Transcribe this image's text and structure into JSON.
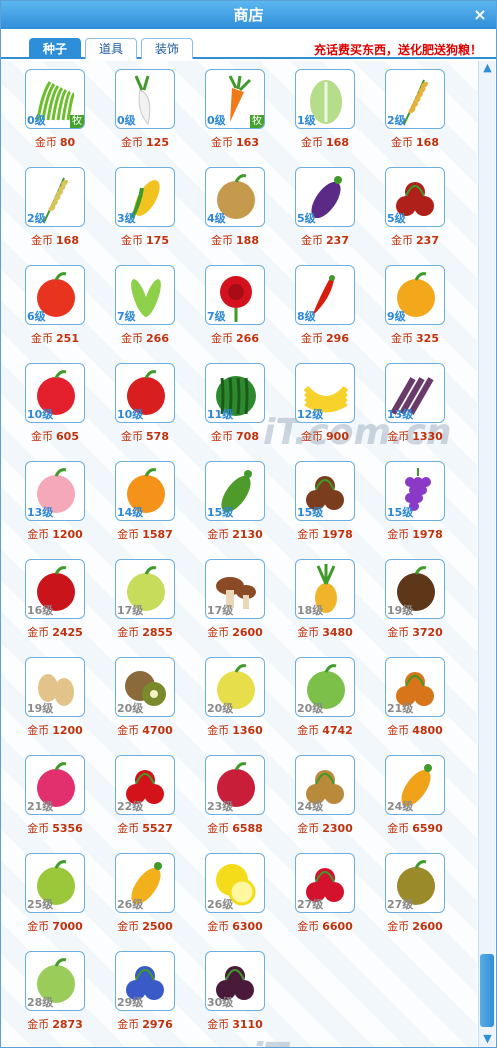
{
  "window": {
    "title": "商店",
    "close_label": "×"
  },
  "tabs": [
    {
      "label": "种子",
      "active": true
    },
    {
      "label": "道具",
      "active": false
    },
    {
      "label": "装饰",
      "active": false
    }
  ],
  "notice": "充话费买东西，送化肥送狗粮！",
  "currency_label": "金币",
  "badge_label": "牧",
  "watermark_text": "iT.com.cn",
  "scroll": {
    "up": "▲",
    "down": "▼"
  },
  "items": [
    {
      "icon": "grass-icon",
      "level": "0级",
      "price": "80",
      "badge": true,
      "color": "#6bbf2c"
    },
    {
      "icon": "radish-icon",
      "level": "0级",
      "price": "125",
      "color": "#f2f2f2"
    },
    {
      "icon": "carrot-icon",
      "level": "0级",
      "price": "163",
      "badge": true,
      "color": "#f07a1a"
    },
    {
      "icon": "cabbage-icon",
      "level": "1级",
      "price": "168",
      "color": "#b6dd8a"
    },
    {
      "icon": "wheat-icon",
      "level": "2级",
      "price": "168",
      "color": "#e8b13a"
    },
    {
      "icon": "rice-icon",
      "level": "2级",
      "price": "168",
      "color": "#d8c45a"
    },
    {
      "icon": "corn-icon",
      "level": "3级",
      "price": "175",
      "color": "#f2c21f"
    },
    {
      "icon": "potato-icon",
      "level": "4级",
      "price": "188",
      "color": "#c59a4c"
    },
    {
      "icon": "eggplant-icon",
      "level": "5级",
      "price": "237",
      "color": "#5a2a86"
    },
    {
      "icon": "jujube-icon",
      "level": "5级",
      "price": "237",
      "color": "#b0201a"
    },
    {
      "icon": "tomato-icon",
      "level": "6级",
      "price": "251",
      "color": "#e8341f"
    },
    {
      "icon": "pea-icon",
      "level": "7级",
      "price": "266",
      "color": "#8ed04a"
    },
    {
      "icon": "rose-icon",
      "level": "7级",
      "price": "266",
      "color": "#d4121e"
    },
    {
      "icon": "chili-icon",
      "level": "8级",
      "price": "296",
      "color": "#d81c10"
    },
    {
      "icon": "pumpkin-icon",
      "level": "9级",
      "price": "325",
      "color": "#f2a81a"
    },
    {
      "icon": "strawberry-icon",
      "level": "10级",
      "price": "605",
      "color": "#e4202e"
    },
    {
      "icon": "apple-icon",
      "level": "10级",
      "price": "578",
      "color": "#d81e1e"
    },
    {
      "icon": "watermelon-icon",
      "level": "11级",
      "price": "708",
      "color": "#2e8a2e"
    },
    {
      "icon": "banana-icon",
      "level": "12级",
      "price": "900",
      "color": "#f6d22a"
    },
    {
      "icon": "sugarcane-icon",
      "level": "13级",
      "price": "1330",
      "color": "#6a3a6a"
    },
    {
      "icon": "peach-icon",
      "level": "13级",
      "price": "1200",
      "color": "#f5a9b8"
    },
    {
      "icon": "orange-icon",
      "level": "14级",
      "price": "1587",
      "color": "#f5921a"
    },
    {
      "icon": "cucumber-icon",
      "level": "15级",
      "price": "2130",
      "color": "#4e9a2a"
    },
    {
      "icon": "chestnut-icon",
      "level": "15级",
      "price": "1978",
      "color": "#7a3e1e"
    },
    {
      "icon": "grape-icon",
      "level": "15级",
      "price": "1978",
      "color": "#8a3ac6"
    },
    {
      "icon": "pomegranate-icon",
      "level": "16级",
      "price": "2425",
      "color": "#c8141a",
      "grey": true
    },
    {
      "icon": "pomelo-icon",
      "level": "17级",
      "price": "2855",
      "color": "#c6dc5a",
      "grey": true
    },
    {
      "icon": "mushroom-icon",
      "level": "17级",
      "price": "2600",
      "color": "#8a4a26",
      "grey": true
    },
    {
      "icon": "pineapple-icon",
      "level": "18级",
      "price": "3480",
      "color": "#f0b42a",
      "grey": true
    },
    {
      "icon": "coconut-icon",
      "level": "19级",
      "price": "3720",
      "color": "#5e3618",
      "grey": true
    },
    {
      "icon": "peanut-icon",
      "level": "19级",
      "price": "1200",
      "color": "#e2c48a",
      "grey": true
    },
    {
      "icon": "kiwi-icon",
      "level": "20级",
      "price": "4700",
      "color": "#7a8a2a",
      "grey": true
    },
    {
      "icon": "pear-icon",
      "level": "20级",
      "price": "1360",
      "color": "#e6de4a",
      "grey": true
    },
    {
      "icon": "gourd-icon",
      "level": "20级",
      "price": "4742",
      "color": "#7cc04a",
      "grey": true
    },
    {
      "icon": "loquat-icon",
      "level": "21级",
      "price": "4800",
      "color": "#d8741a",
      "grey": true
    },
    {
      "icon": "dragonfruit-icon",
      "level": "21级",
      "price": "5356",
      "color": "#e2306e",
      "grey": true
    },
    {
      "icon": "cherry-icon",
      "level": "22级",
      "price": "5527",
      "color": "#d4121a",
      "grey": true
    },
    {
      "icon": "lychee-icon",
      "level": "23级",
      "price": "6588",
      "color": "#c81e3a",
      "grey": true
    },
    {
      "icon": "longan-icon",
      "level": "24级",
      "price": "2300",
      "color": "#b88a3a",
      "grey": true
    },
    {
      "icon": "papaya-icon",
      "level": "24级",
      "price": "6590",
      "color": "#f0a21a",
      "grey": true
    },
    {
      "icon": "starfruit-icon",
      "level": "25级",
      "price": "7000",
      "color": "#9ac83a",
      "grey": true
    },
    {
      "icon": "mango-icon",
      "level": "26级",
      "price": "2500",
      "color": "#f2b01a",
      "grey": true
    },
    {
      "icon": "lemon-icon",
      "level": "26级",
      "price": "6300",
      "color": "#f5dc1a",
      "grey": true
    },
    {
      "icon": "raspberry-icon",
      "level": "27级",
      "price": "6600",
      "color": "#d4122e",
      "grey": true
    },
    {
      "icon": "durian-icon",
      "level": "27级",
      "price": "2600",
      "color": "#9a8a2a",
      "grey": true
    },
    {
      "icon": "guava-icon",
      "level": "28级",
      "price": "2873",
      "color": "#9acc5a",
      "grey": true
    },
    {
      "icon": "blueberry-icon",
      "level": "29级",
      "price": "2976",
      "color": "#3a5ac8",
      "grey": true
    },
    {
      "icon": "mangosteen-icon",
      "level": "30级",
      "price": "3110",
      "color": "#4a1a3a",
      "grey": true
    }
  ]
}
